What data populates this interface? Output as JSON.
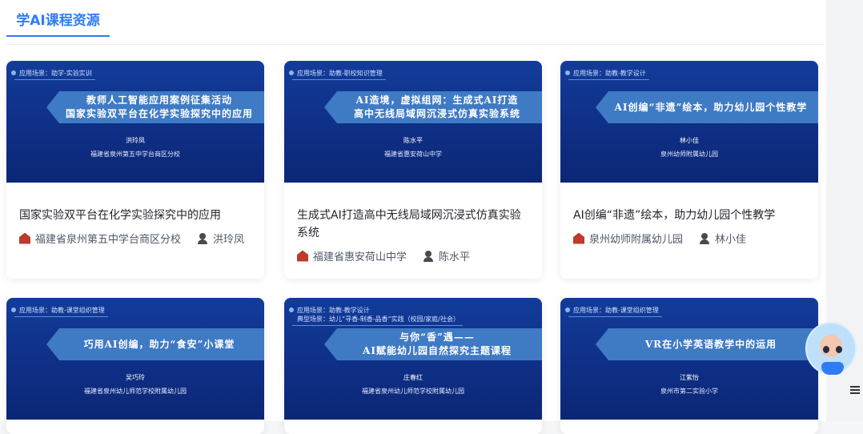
{
  "header": {
    "tab_label": "学AI课程资源"
  },
  "cards": [
    {
      "scene": "应用场景：助学-实验实训",
      "banner": [
        "教师人工智能应用案例征集活动",
        "国家实验双平台在化学实验探究中的应用"
      ],
      "author": "洪玲凤",
      "school": "福建省泉州第五中学台商区分校",
      "title": "国家实验双平台在化学实验探究中的应用"
    },
    {
      "scene": "应用场景：助教-职校知识管理",
      "banner": [
        "AI造境，虚拟组网：生成式AI打造",
        "高中无线局域网沉浸式仿真实验系统"
      ],
      "author": "陈水平",
      "school": "福建省惠安荷山中学",
      "title": "生成式AI打造高中无线局域网沉浸式仿真实验系统"
    },
    {
      "scene": "应用场景：助教-教学设计",
      "banner": [
        "AI创编“非遗”绘本，助力幼儿园个性教学",
        ""
      ],
      "author": "林小佳",
      "school": "泉州幼师附属幼儿园",
      "title": "AI创编“非遗”绘本，助力幼儿园个性教学"
    },
    {
      "scene": "应用场景：助教-课堂组织管理",
      "banner": [
        "巧用AI创编，助力“食安”小课堂",
        ""
      ],
      "author": "吴巧玲",
      "school": "福建省泉州幼儿师范学校附属幼儿园",
      "title": ""
    },
    {
      "scene": "应用场景：助教-教学设计",
      "scene2": "典型场景：幼儿“寻香-制香-品香”实践（校园/家庭/社会）",
      "banner": [
        "与你“香”遇——",
        "AI赋能幼儿园自然探究主题课程"
      ],
      "author": "庄春红",
      "school": "福建省泉州幼儿师范学校附属幼儿园",
      "title": ""
    },
    {
      "scene": "应用场景：助教-课堂组织管理",
      "banner": [
        "VR在小学英语教学中的运用",
        ""
      ],
      "author": "江紫怡",
      "school": "泉州市第二实验小学",
      "title": ""
    }
  ]
}
